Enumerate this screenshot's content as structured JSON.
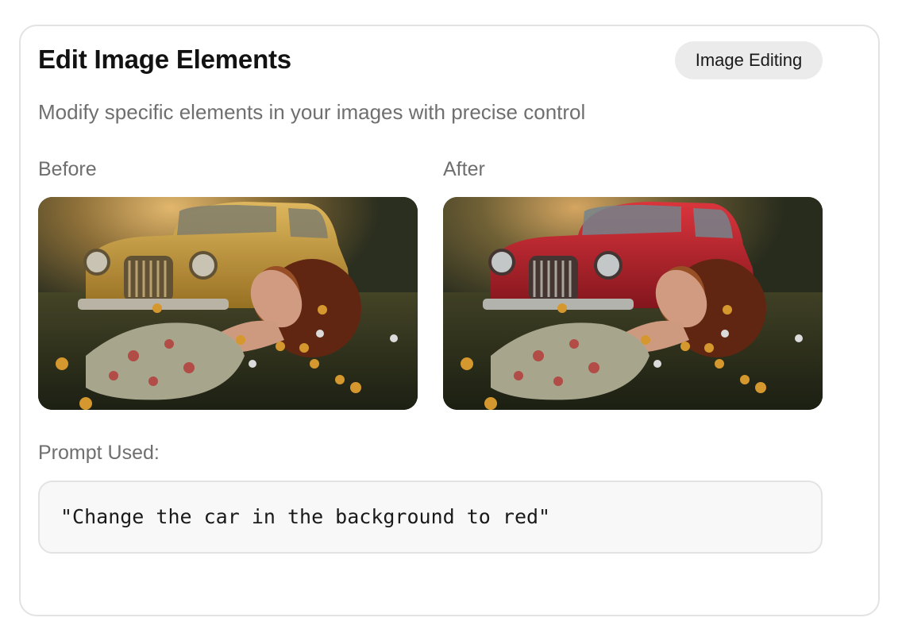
{
  "card": {
    "title": "Edit Image Elements",
    "badge": "Image Editing",
    "subtitle": "Modify specific elements in your images with precise control"
  },
  "comparison": {
    "before_label": "Before",
    "after_label": "After",
    "before_car_color": "#d9a93a",
    "after_car_color": "#d4202b"
  },
  "prompt": {
    "label": "Prompt Used:",
    "text": "\"Change the car in the background to red\""
  },
  "colors": {
    "text_primary": "#121212",
    "text_secondary": "#6f6f6f",
    "border": "#e3e3e3",
    "badge_bg": "#ebebeb",
    "prompt_bg": "#f8f8f8"
  }
}
